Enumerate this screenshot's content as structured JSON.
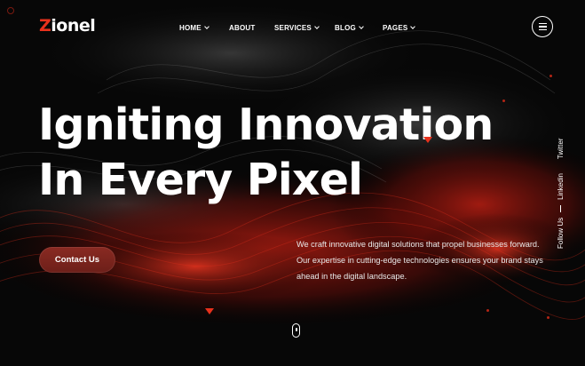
{
  "brand": {
    "logo_initial": "Z",
    "logo_rest": "ionel",
    "accent_color": "#e8311c"
  },
  "nav": {
    "items": [
      {
        "label": "HOME",
        "has_dropdown": true
      },
      {
        "label": "ABOUT",
        "has_dropdown": false
      },
      {
        "label": "SERVICES",
        "has_dropdown": true
      },
      {
        "label": "BLOG",
        "has_dropdown": true
      },
      {
        "label": "PAGES",
        "has_dropdown": true
      }
    ],
    "menu_icon": "hamburger-menu-icon"
  },
  "hero": {
    "headline_line1": "Igniting Innovation",
    "headline_line2": "In Every Pixel",
    "description": "We craft innovative digital solutions that propel businesses forward. Our expertise in cutting-edge technologies ensures your brand stays ahead in the digital landscape.",
    "cta_label": "Contact Us"
  },
  "social": {
    "follow_label": "Follow Us",
    "links": [
      "Linkedin",
      "Twitter"
    ]
  },
  "scroll_indicator_icon": "scroll-mouse-icon"
}
